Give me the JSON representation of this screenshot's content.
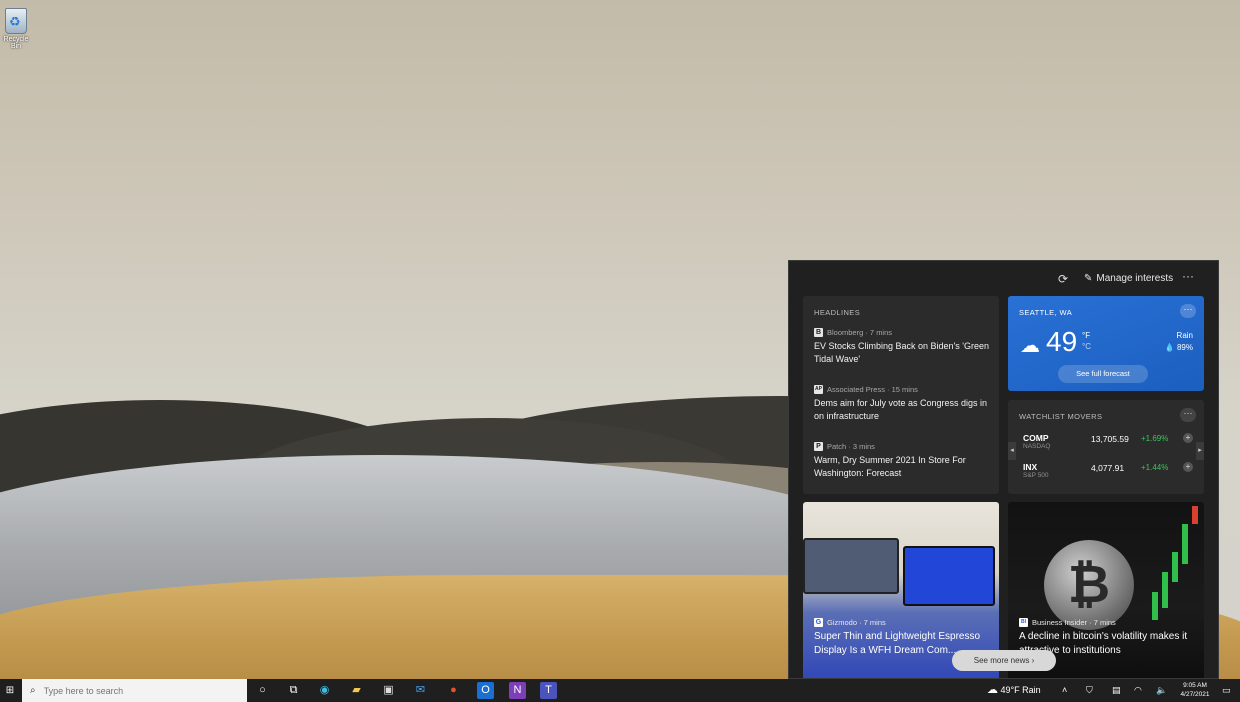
{
  "desktop": {
    "recycle_label": "Recycle Bin"
  },
  "panel": {
    "manage_label": "Manage interests",
    "more_icon": "more-icon",
    "refresh_icon": "refresh-icon"
  },
  "headlines": {
    "title": "HEADLINES",
    "stories": [
      {
        "source": "Bloomberg · 7 mins",
        "logo": "B",
        "title": "EV Stocks Climbing Back on Biden's 'Green Tidal Wave'"
      },
      {
        "source": "Associated Press · 15 mins",
        "logo": "AP",
        "title": "Dems aim for July vote as Congress digs in on infrastructure"
      },
      {
        "source": "Patch · 3 mins",
        "logo": "P",
        "title": "Warm, Dry Summer 2021 In Store For Washington: Forecast"
      }
    ]
  },
  "weather": {
    "city": "SEATTLE, WA",
    "temp": "49",
    "unit_f": "°F",
    "unit_c": "°C",
    "condition": "Rain",
    "precip": "💧 89%",
    "forecast_label": "See full forecast",
    "color": "#2a71d6"
  },
  "watchlist": {
    "title": "WATCHLIST MOVERS",
    "stocks": [
      {
        "symbol": "COMP",
        "exchange": "NASDAQ",
        "value": "13,705.59",
        "change": "+1.69%"
      },
      {
        "symbol": "INX",
        "exchange": "S&P 500",
        "value": "4,077.91",
        "change": "+1.44%"
      }
    ],
    "positive_color": "#3cc35a"
  },
  "news_cards": [
    {
      "source": "Gizmodo · 7 mins",
      "logo": "G",
      "title": "Super Thin and Lightweight Espresso Display Is a WFH Dream Com..."
    },
    {
      "source": "Business Insider · 7 mins",
      "logo": "BI",
      "title": "A decline in bitcoin's volatility makes it attractive to institutions"
    }
  ],
  "see_more_label": "See more news  ›",
  "taskbar": {
    "search_placeholder": "Type here to search",
    "weather_text": "49°F  Rain",
    "time": "9:05 AM",
    "date": "4/27/2021"
  }
}
